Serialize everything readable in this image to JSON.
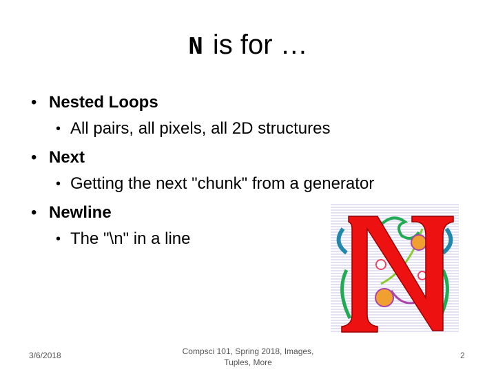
{
  "slide": {
    "title_letter": "N",
    "title_rest": "is for …",
    "bullets": [
      {
        "label": "Nested Loops",
        "sub": "All pairs, all pixels, all 2D structures"
      },
      {
        "label": "Next",
        "sub": "Getting the next \"chunk\" from a generator"
      },
      {
        "label": "Newline",
        "sub": "The \"\\n\" in a line"
      }
    ],
    "illustration": {
      "letter": "N",
      "letter_color": "#ee1111",
      "icon": "illuminated-letter-n"
    }
  },
  "footer": {
    "date": "3/6/2018",
    "center_line1": "Compsci 101, Spring 2018,  Images,",
    "center_line2": "Tuples, More",
    "page": "2"
  }
}
